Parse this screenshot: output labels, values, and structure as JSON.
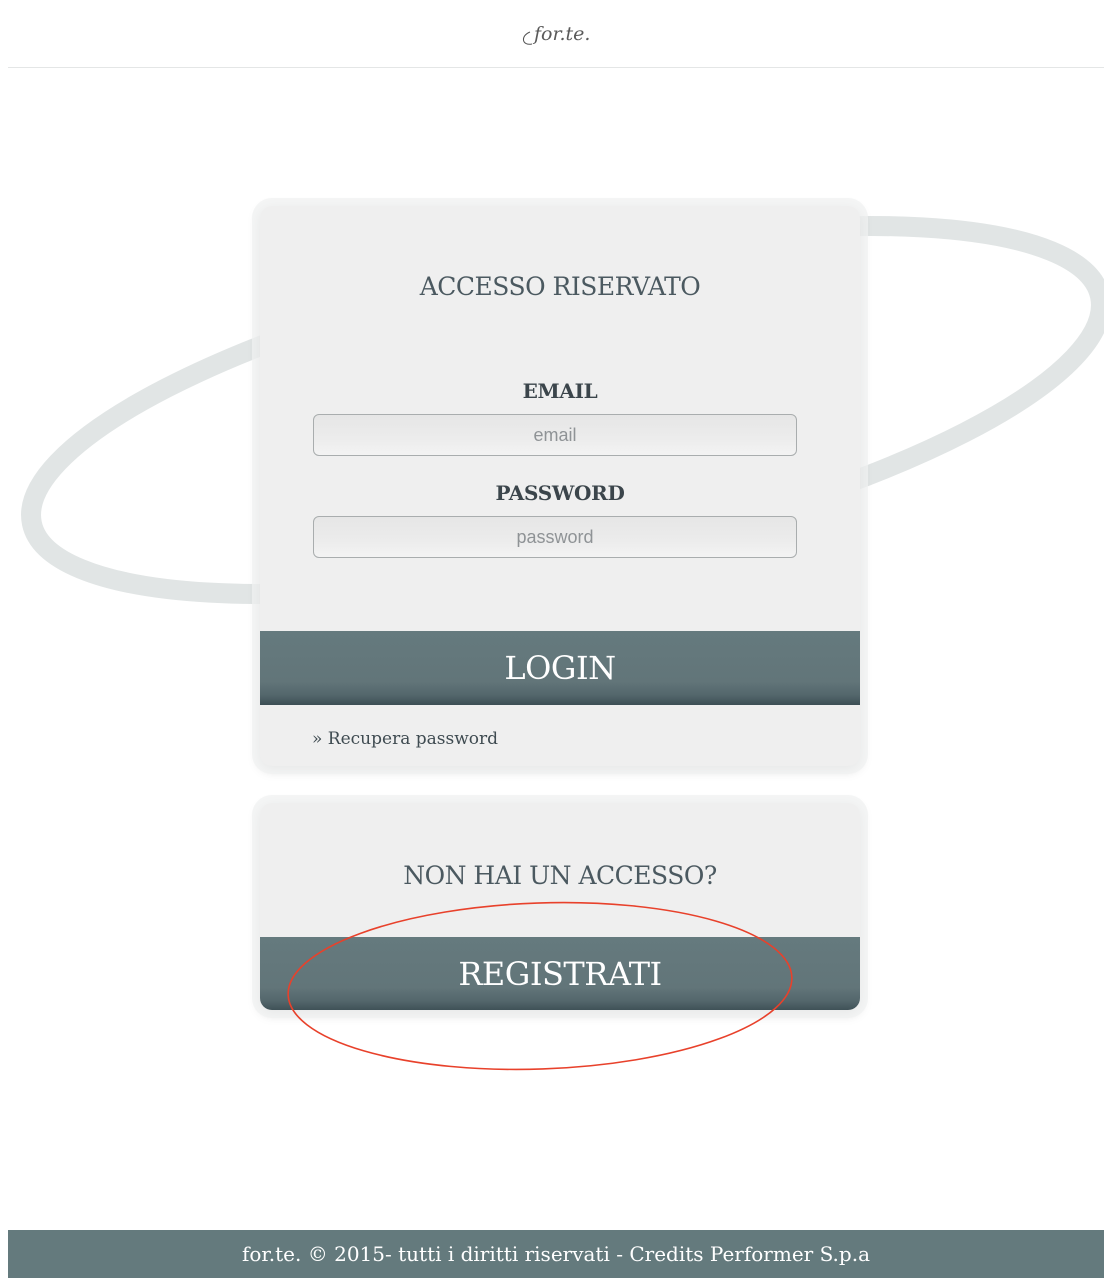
{
  "brand": {
    "logo_text": "for.te."
  },
  "login_card": {
    "title": "ACCESSO RISERVATO",
    "email_label": "EMAIL",
    "email_placeholder": "email",
    "password_label": "PASSWORD",
    "password_placeholder": "password",
    "login_button": "LOGIN",
    "recover_link": "» Recupera password"
  },
  "register_card": {
    "title": "NON HAI UN ACCESSO?",
    "register_button": "REGISTRATI"
  },
  "footer": {
    "text": "for.te. © 2015- tutti i diritti riservati - Credits Performer S.p.a"
  },
  "colors": {
    "button_bg": "#627579",
    "footer_bg": "#647a7d",
    "card_bg": "#efefef",
    "annotation": "#e8412b",
    "orbit": "#e1e5e5"
  }
}
